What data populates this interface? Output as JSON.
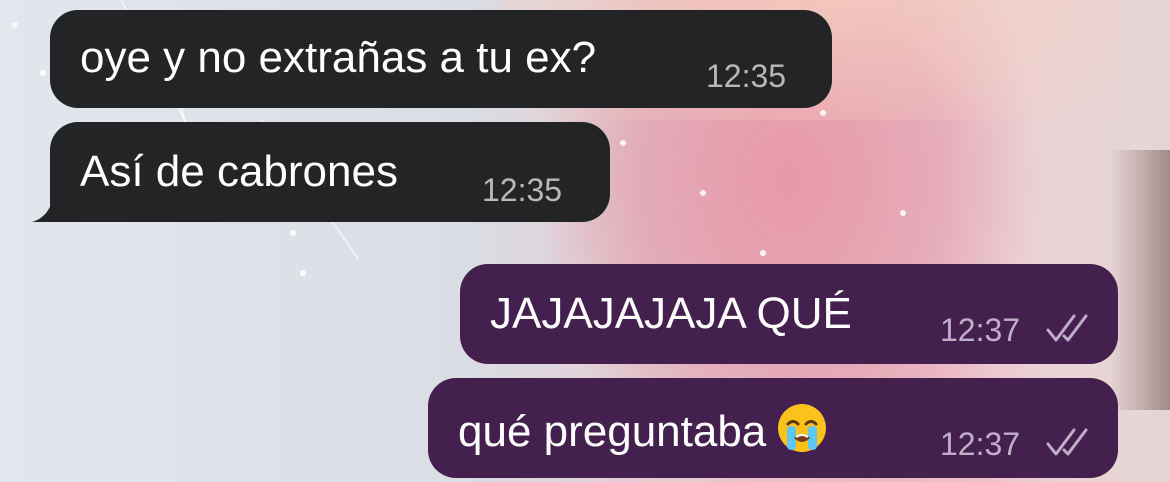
{
  "messages": [
    {
      "direction": "incoming",
      "text": "oye y no extrañas a tu ex?",
      "time": "12:35"
    },
    {
      "direction": "incoming",
      "text": "Así de cabrones",
      "time": "12:35"
    },
    {
      "direction": "outgoing",
      "text": "JAJAJAJAJA QUÉ",
      "time": "12:37",
      "status": "read"
    },
    {
      "direction": "outgoing",
      "text": "qué preguntaba",
      "time": "12:37",
      "status": "read",
      "emoji": "loudly-crying-face-emoji"
    }
  ],
  "colors": {
    "incoming_bubble": "#222426",
    "outgoing_bubble": "#44204f",
    "text": "#ffffff",
    "time": "#c8c8cc"
  }
}
